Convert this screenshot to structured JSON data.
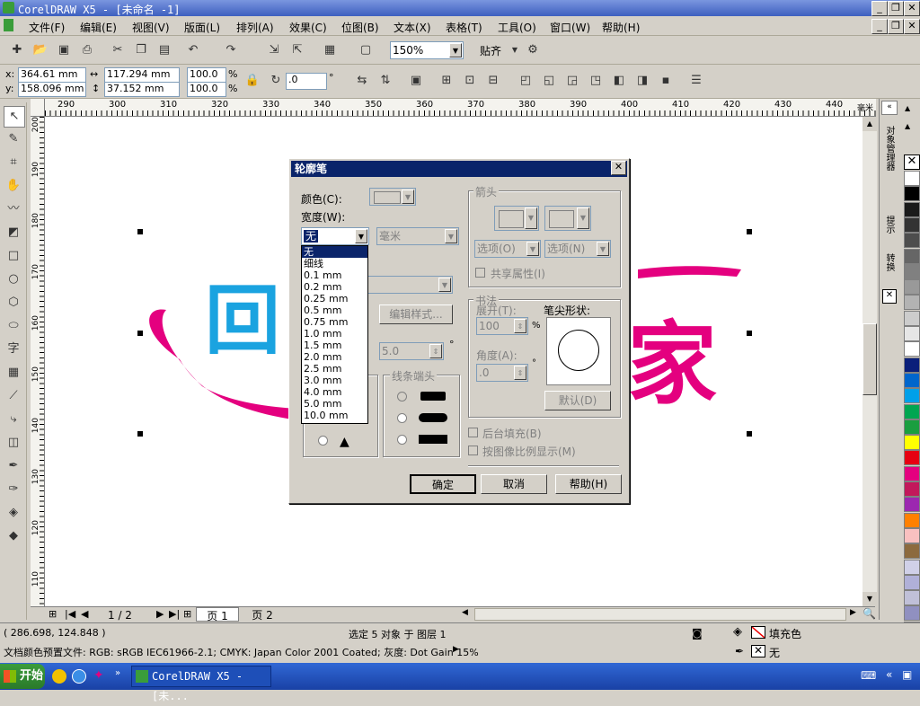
{
  "window": {
    "title": "CorelDRAW X5 - [未命名 -1]"
  },
  "menu": [
    "文件(F)",
    "编辑(E)",
    "视图(V)",
    "版面(L)",
    "排列(A)",
    "效果(C)",
    "位图(B)",
    "文本(X)",
    "表格(T)",
    "工具(O)",
    "窗口(W)",
    "帮助(H)"
  ],
  "toolbar": {
    "zoom": "150%",
    "snap_label": "贴齐"
  },
  "properties": {
    "x": "364.61 mm",
    "y": "158.096 mm",
    "w": "117.294 mm",
    "h": "37.152 mm",
    "sx": "100.0",
    "sy": "100.0",
    "pct": "%",
    "angle": ".0",
    "deg": "°",
    "x_label": "x:",
    "y_label": "y:"
  },
  "ruler_h": [
    "290",
    "300",
    "310",
    "320",
    "330",
    "340",
    "350",
    "360",
    "370",
    "380",
    "390",
    "400",
    "410",
    "420",
    "430",
    "440"
  ],
  "ruler_h_unit": "毫米",
  "ruler_v": [
    "200",
    "190",
    "180",
    "170",
    "160",
    "150",
    "140",
    "130",
    "120",
    "110"
  ],
  "canvas_text": {
    "left_char": "回",
    "right_char": "家"
  },
  "dialog": {
    "title": "轮廓笔",
    "color_label": "颜色(C):",
    "width_label": "宽度(W):",
    "width_value": "无",
    "unit_value": "毫米",
    "edit_style": "编辑样式...",
    "miter_value": "5.0",
    "line_cap_title": "线条端头",
    "arrows_title": "箭头",
    "options_left": "选项(O)",
    "options_right": "选项(N)",
    "share_attr": "共享属性(I)",
    "calligraphy_title": "书法",
    "stretch_label": "展开(T):",
    "stretch_value": "100",
    "nib_label": "笔尖形状:",
    "angle_label": "角度(A):",
    "angle_value": ".0",
    "default_btn": "默认(D)",
    "behind_fill": "后台填充(B)",
    "scale_image": "按图像比例显示(M)",
    "ok": "确定",
    "cancel": "取消",
    "help": "帮助(H)",
    "width_options": [
      "无",
      "细线",
      "0.1 mm",
      "0.2 mm",
      "0.25 mm",
      "0.5 mm",
      "0.75 mm",
      "1.0 mm",
      "1.5 mm",
      "2.0 mm",
      "2.5 mm",
      "3.0 mm",
      "4.0 mm",
      "5.0 mm",
      "10.0 mm"
    ]
  },
  "pages": {
    "counter": "1 / 2",
    "tab1": "页 1",
    "tab2": "页 2"
  },
  "docker": {
    "tab1": "对象管理器",
    "tab2": "提示",
    "tab3": "转换"
  },
  "status": {
    "coords": "( 286.698, 124.848 )",
    "selection": "选定 5 对象 于 图层 1",
    "profile": "文档颜色预置文件: RGB: sRGB IEC61966-2.1; CMYK: Japan Color 2001 Coated; 灰度: Dot Gain 15%",
    "fill_label": "填充色",
    "outline_label": "无"
  },
  "taskbar": {
    "start": "开始",
    "task": "CorelDRAW X5 - [未..."
  },
  "palette_colors": [
    "#ffffff",
    "#000000",
    "#1a1a1a",
    "#333333",
    "#4d4d4d",
    "#666666",
    "#808080",
    "#999999",
    "#b3b3b3",
    "#cccccc",
    "#e6e6e6",
    "#ffffff",
    "#0a1f7a",
    "#0066cc",
    "#00a0e9",
    "#00a651",
    "#1a9e3f",
    "#ffff00",
    "#e60012",
    "#e4007f",
    "#c2185b",
    "#9c27b0",
    "#ff8000",
    "#f9c0c0",
    "#8c6a3e",
    "#d0d0e8",
    "#b0b0d8",
    "#c0c0d8",
    "#9090c0",
    "#6a6aa8",
    "#5a5a98"
  ],
  "brand_colors": {
    "cyan": "#1aa3e0",
    "magenta": "#e4007f"
  }
}
